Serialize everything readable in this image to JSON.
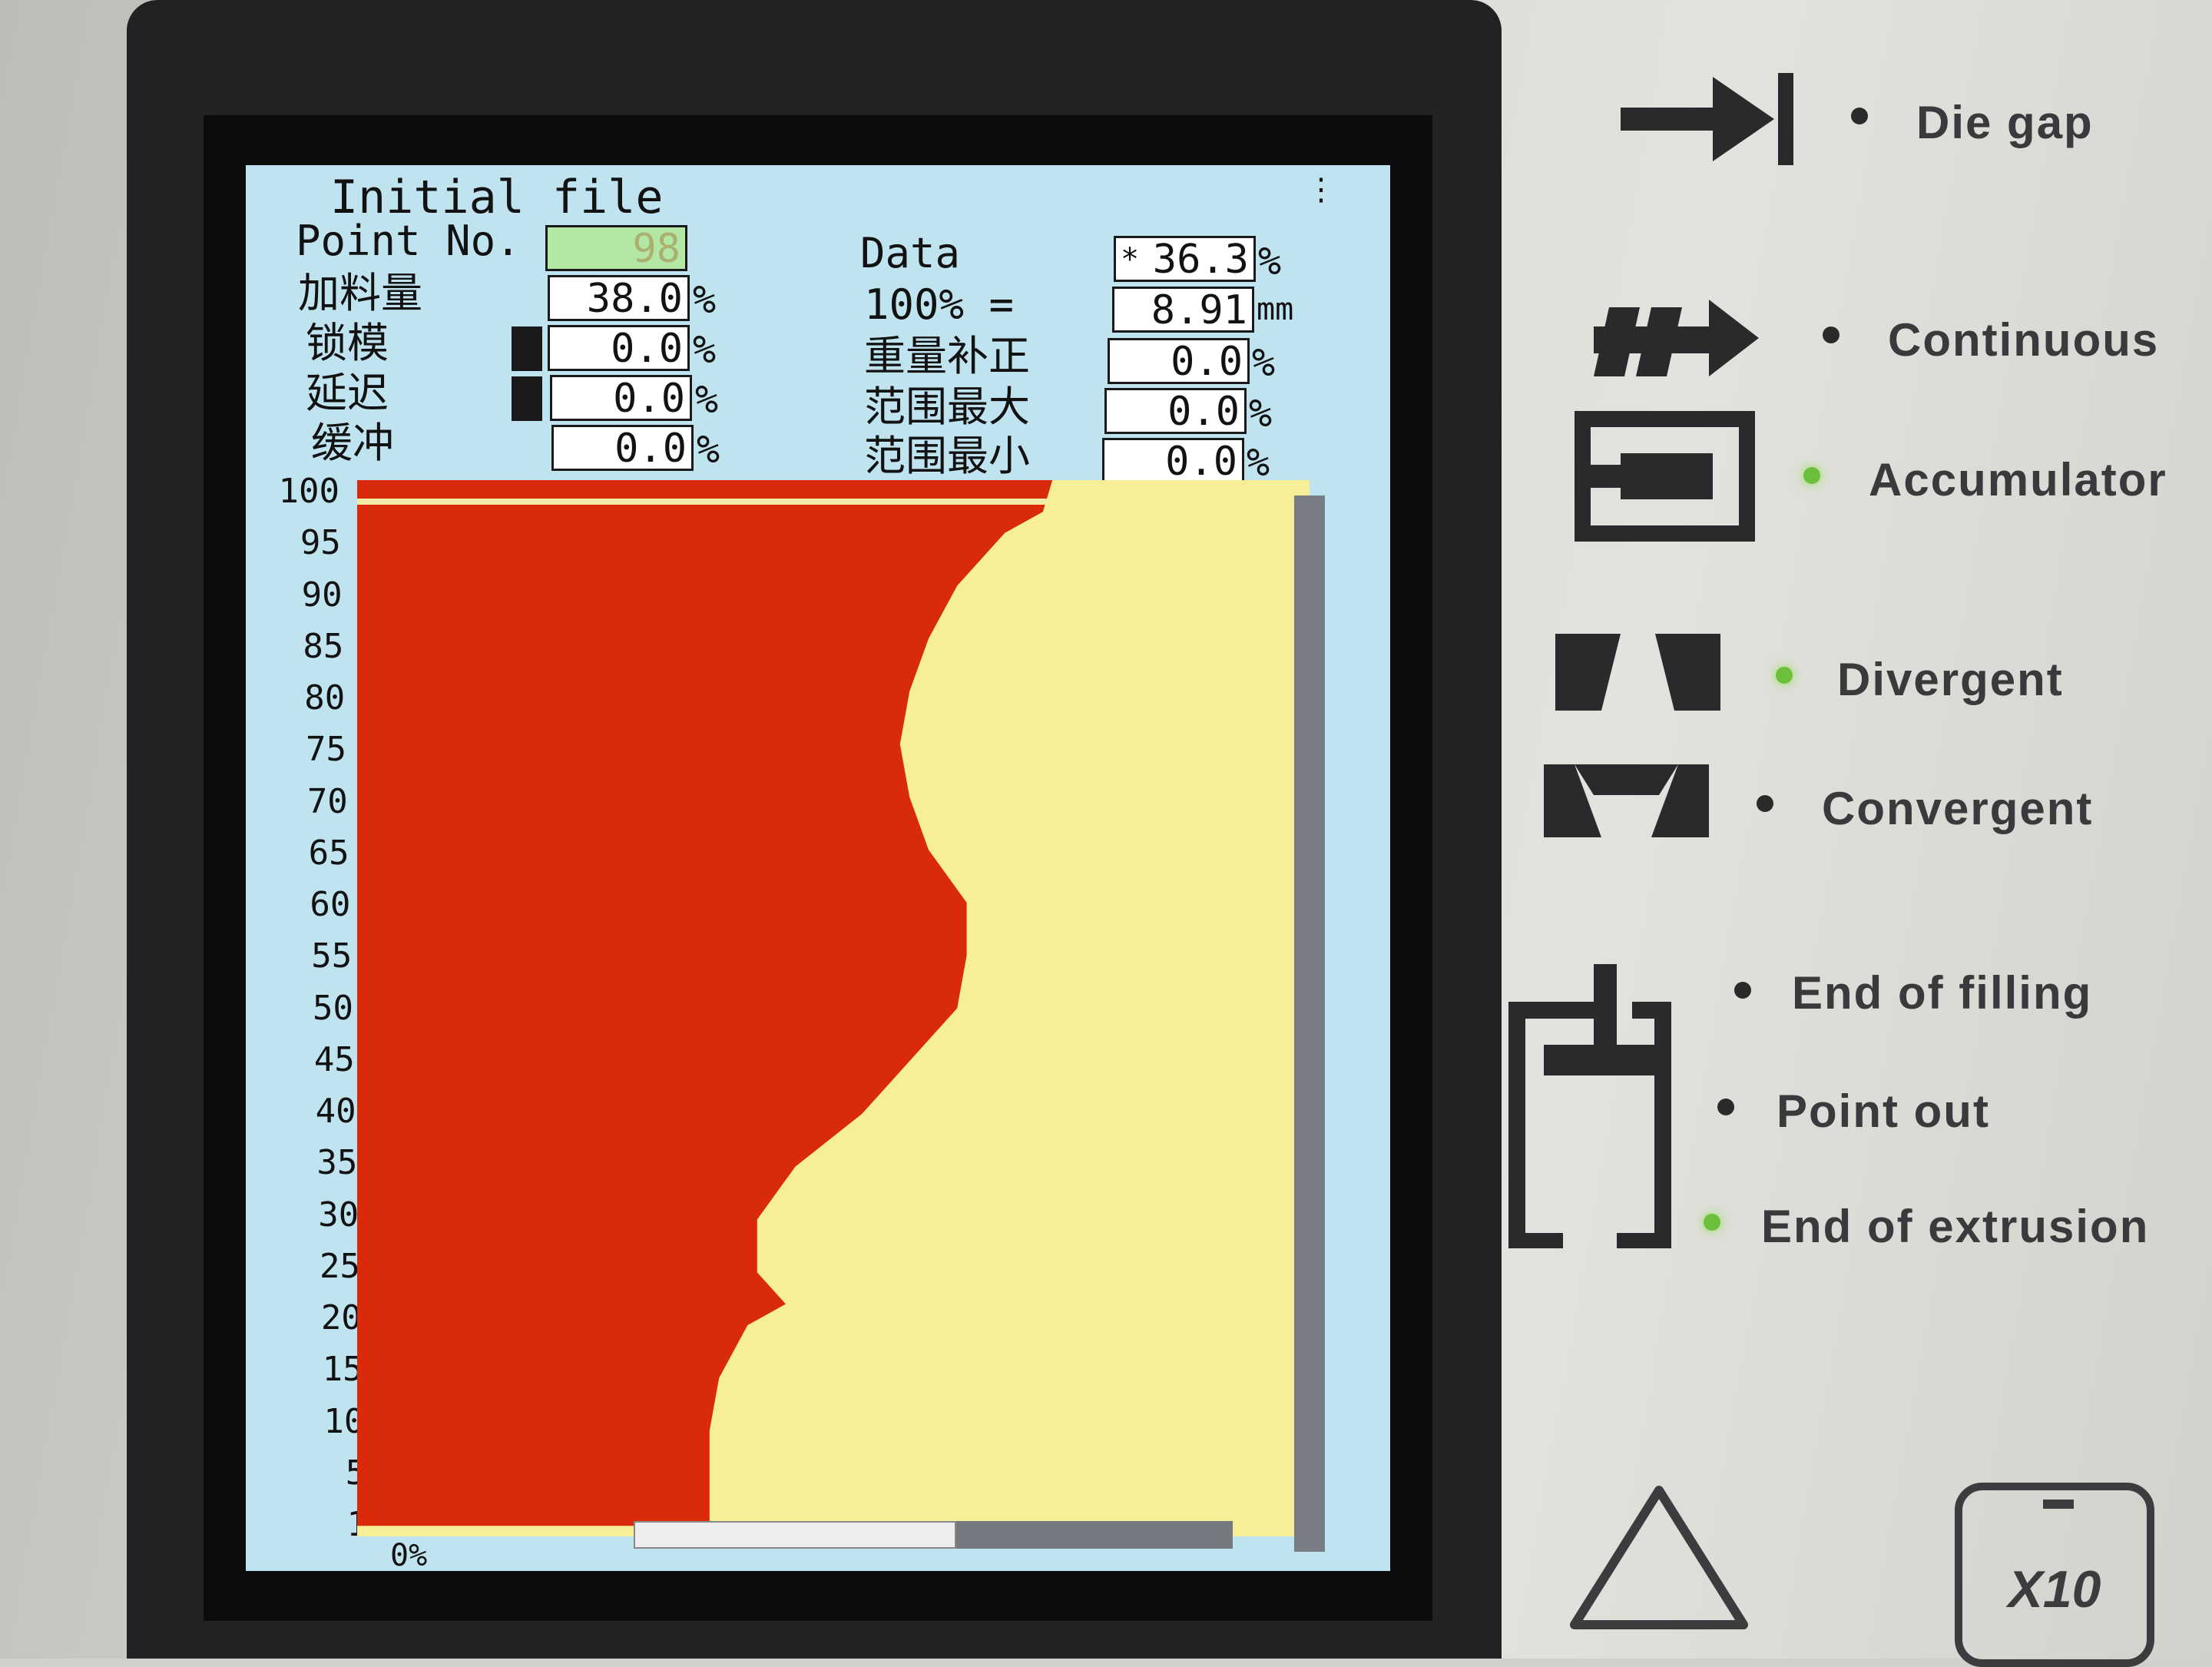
{
  "screen": {
    "title": "Initial file",
    "fields": {
      "point_no": {
        "label": "Point No.",
        "value": "98"
      },
      "feed": {
        "label": "加料量",
        "value": "38.0",
        "unit": "%"
      },
      "lock": {
        "label": "锁模",
        "value": "0.0",
        "unit": "%"
      },
      "delay": {
        "label": "延迟",
        "value": "0.0",
        "unit": "%"
      },
      "buffer": {
        "label": "缓冲",
        "value": "0.0",
        "unit": "%"
      },
      "data": {
        "label": "Data",
        "value": "36.3",
        "prefix": "*",
        "unit": "%"
      },
      "hundred": {
        "label": "100% =",
        "value": "8.91",
        "unit": "mm"
      },
      "weight": {
        "label": "重量补正",
        "value": "0.0",
        "unit": "%"
      },
      "range_max": {
        "label": "范围最大",
        "value": "0.0",
        "unit": "%"
      },
      "range_min": {
        "label": "范围最小",
        "value": "0.0",
        "unit": "%"
      }
    },
    "y_ticks": [
      "100",
      "95",
      "90",
      "85",
      "80",
      "75",
      "70",
      "65",
      "60",
      "55",
      "50",
      "45",
      "40",
      "35",
      "30",
      "25",
      "20",
      "15",
      "10",
      "5",
      "1"
    ],
    "x_start_label": "0%"
  },
  "chart_data": {
    "type": "area",
    "x": [
      100,
      97,
      95,
      90,
      85,
      80,
      75,
      70,
      65,
      60,
      55,
      50,
      45,
      40,
      35,
      30,
      25,
      22,
      20,
      15,
      10,
      5,
      1
    ],
    "values": [
      73,
      72,
      68,
      63,
      60,
      58,
      57,
      58,
      60,
      64,
      64,
      63,
      58,
      53,
      46,
      42,
      42,
      45,
      41,
      38,
      37,
      37,
      37
    ],
    "series": [
      {
        "values": [
          73,
          72,
          68,
          63,
          60,
          58,
          57,
          58,
          60,
          64,
          64,
          63,
          58,
          53,
          46,
          42,
          42,
          45,
          41,
          38,
          37,
          37,
          37
        ]
      }
    ],
    "ylim": [
      0,
      100
    ],
    "yticks": [
      100,
      95,
      90,
      85,
      80,
      75,
      70,
      65,
      60,
      55,
      50,
      45,
      40,
      35,
      30,
      25,
      20,
      15,
      10,
      5,
      1
    ],
    "colors": {
      "filled": "#d92a0c",
      "empty": "#f6ef98"
    }
  },
  "panel": {
    "die_gap": "Die gap",
    "continuous": "Continuous",
    "accumulator": "Accumulator",
    "divergent": "Divergent",
    "convergent": "Convergent",
    "end_of_filling": "End of filling",
    "point_out": "Point out",
    "end_of_extrusion": "End of extrusion",
    "x10_key": "X10",
    "leds": {
      "accumulator": "on",
      "divergent": "on",
      "end_of_extrusion": "on"
    }
  }
}
